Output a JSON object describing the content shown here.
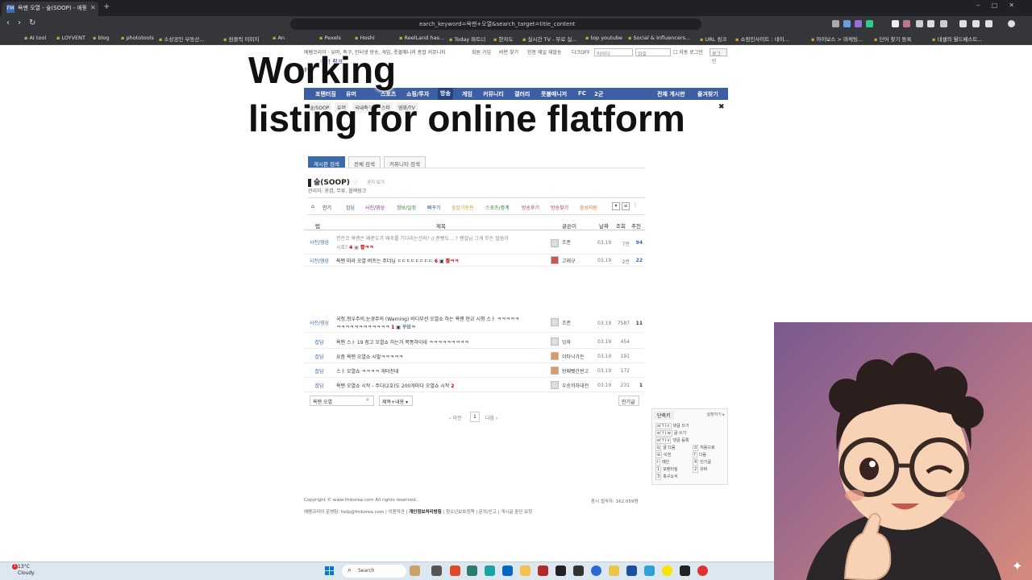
{
  "browser": {
    "tab_title": "욕맨 오열 - 숲(SOOP) - 에펨코리아",
    "tab_favicon": "FM",
    "url_fragment": "earch_keyword=욕맨+오열&search_target=title_content",
    "bookmarks": [
      "AI tool",
      "LOYVENT",
      "blog",
      "phototools",
      "소상공인 부동산...",
      "원클릭 이미지",
      "An",
      "Pexels",
      "Hoshi",
      "ReelLand has...",
      "Today 파트너",
      "한자도",
      "실시간 TV - 무료 실...",
      "top youtube",
      "Social & Influencers...",
      "URL 링크",
      "쇼핑인사이트 : 네이...",
      "아이보스 > 마케팅...",
      "단어 찾기 등록",
      "네셀의 월드베스트..."
    ]
  },
  "overlay": {
    "line1": "Working",
    "line2": "listing for online flatform"
  },
  "site": {
    "util_desc": "에펨코리아 · 유머, 축구, 인터넷 방송, 게임, 풋볼매니저 종합 커뮤니티",
    "util_links": [
      "회원 가입",
      "비번 찾기",
      "인증 메일 재발송",
      "다크OFF"
    ],
    "id_placeholder": "아이디",
    "pw_placeholder": "암호",
    "auto_login": "자동 로그인",
    "login_btn": "로그인",
    "logo_text": "착한 링크",
    "menu": [
      "포텐터짐",
      "유머",
      "스포츠",
      "쇼핑/투자",
      "방송",
      "게임",
      "커뮤니티",
      "갤러리",
      "풋볼매니저",
      "FC",
      "2군",
      "전체 게시판",
      "즐겨찾기"
    ],
    "submenu": [
      "숲/SOOP",
      "유머",
      "국내축구",
      "스타",
      "영화/TV"
    ]
  },
  "search_tabs": [
    "게시판 검색",
    "전체 검색",
    "커뮤니티 검색"
  ],
  "board": {
    "title": "숲(SOOP)",
    "link": "공지 보기",
    "admin": "관리자: 용겸, 무류, 블랙링크",
    "categories": [
      "인기",
      "잡담",
      "사진/영상",
      "정보/일정",
      "빠꾸기",
      "숲잡기장판",
      "스포츠/중계",
      "방송후기",
      "방송찾기",
      "음성지원"
    ],
    "headers": {
      "tab": "탭",
      "title": "제목",
      "writer": "글쓴이",
      "date": "날짜",
      "views": "조회",
      "rec": "추천"
    },
    "rows": [
      {
        "tab": "사진/영상",
        "title1": "컨잔코 욕맨은 왜준도가 왜주를 기다리는건지? // 준빵도 ...? 왠걸님 그게 무슨 말씀이",
        "title2": "시죠?",
        "comments": "4",
        "hot": "짤ㅋㅋ",
        "writer": "조준",
        "date": "03.19",
        "views": "7만",
        "rec": "94"
      },
      {
        "tab": "사진/영상",
        "title1": "욕맨 따라 오열 버프는 주더님 ㄷㄷㄷㄷㄷㄷㄷㄷ",
        "comments": "6",
        "hot": "짤ㅋㅋ",
        "writer": "고래규",
        "date": "03.19",
        "views": "2만",
        "rec": "22"
      },
      {
        "tab": "사진/영상",
        "title1": "국청,청우주의,눈경주의 (Warning) 바디부션 오열쇼 하는 욕맨 현교 시청 스ㅏ ㅋㅋㅋㅋㅋ",
        "title2": "ㅋㅋㅋㅋㅋㅋㅋㅋㅋㅋㅋㅋ",
        "comments": "1",
        "hot": "꾸요ㅋ",
        "writer": "조준",
        "date": "03.19",
        "views": "7587",
        "rec": "11"
      },
      {
        "tab": "잡담",
        "title1": "욕맨 스ㅏ 19 점고 오열쇼 하는거 쪽퐁하이네 ㅋㅋㅋㅋㅋㅋㅋㅋㅋ",
        "writer": "잉와",
        "date": "03.19",
        "views": "454",
        "rec": ""
      },
      {
        "tab": "잡담",
        "title1": "요즘 욕맨 오열쇼 시발ㅋㅋㅋㅋㅋ",
        "writer": "이타낙가든",
        "date": "03.19",
        "views": "191",
        "rec": ""
      },
      {
        "tab": "잡담",
        "title1": "스ㅏ 오열쇼 ㅋㅋㅋㅋ 개터진네",
        "writer": "방패빳간씬고",
        "date": "03.19",
        "views": "172",
        "rec": ""
      },
      {
        "tab": "잡담",
        "title1": "욕맨 오열쇼 시작 - 주다(2호)도 200개마다 오열쇼 시작",
        "comments": "2",
        "writer": "우승까자대전",
        "date": "03.19",
        "views": "231",
        "rec": "1"
      }
    ]
  },
  "search": {
    "value": "욕맨 오열",
    "target": "제목+내용",
    "popular_btn": "인기글"
  },
  "pager": {
    "prev": "‹ 이전",
    "current": "1",
    "next": "다음 ›"
  },
  "shortcut": {
    "title": "단축키",
    "settings": "설정하기 ▸",
    "items": [
      {
        "key": "a(↑)·c",
        "label": "댓글 쓰기"
      },
      {
        "key": "e(↑)·w",
        "label": "글 쓰기"
      },
      {
        "key": "e(↑)·s",
        "label": "댓글 등록"
      },
      {
        "key": "q",
        "label": "글 다음"
      },
      {
        "key": "d",
        "label": "처음으로"
      },
      {
        "key": "w",
        "label": "이전"
      },
      {
        "key": "f",
        "label": "다음"
      },
      {
        "key": "r",
        "label": "메인"
      },
      {
        "key": "4",
        "label": "인기글"
      },
      {
        "key": "1",
        "label": "포텐터짐"
      },
      {
        "key": "2",
        "label": "유머"
      },
      {
        "key": "3",
        "label": "축구소식"
      }
    ]
  },
  "footer": {
    "copyright": "Copyright © www.fmkorea.com All rights reserved.",
    "visitors": "동시 접속자: 162,059명",
    "links_prefix": "에펨코리아 운영팀: help@fmkorea.com | 이용약관 |",
    "privacy": "개인정보처리방침",
    "links_suffix": "| 청소년보호정책 | 문의/신고 | 게시글 중단 요청"
  },
  "taskbar": {
    "temp": "13°C",
    "condition": "Cloudy",
    "badge": "1",
    "search_label": "Search"
  },
  "colors": {
    "menu": "#3b5ea5",
    "accent": "#3b6aa8",
    "hot": "#cc0000"
  }
}
